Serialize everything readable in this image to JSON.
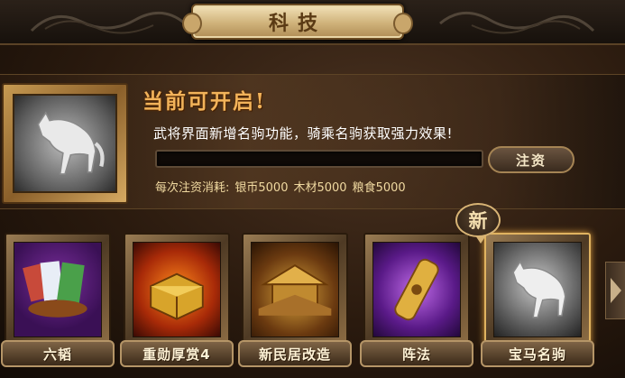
{
  "header": {
    "title": "科技"
  },
  "info": {
    "headline": "当前可开启!",
    "description": "武将界面新增名驹功能，骑乘名驹获取强力效果!",
    "progress_fraction": 0,
    "invest_label": "注资",
    "cost_label": "每次注资消耗:",
    "costs": [
      "银币5000",
      "木材5000",
      "粮食5000"
    ]
  },
  "techs": [
    {
      "label": "六韬"
    },
    {
      "label": "重勋厚赏4"
    },
    {
      "label": "新民居改造"
    },
    {
      "label": "阵法"
    },
    {
      "label": "宝马名驹"
    }
  ],
  "badge": {
    "new_label": "新"
  },
  "colors": {
    "accent": "#f2b35a",
    "frame_gold": "#c79a52",
    "selected_glow": "#e0a040"
  }
}
